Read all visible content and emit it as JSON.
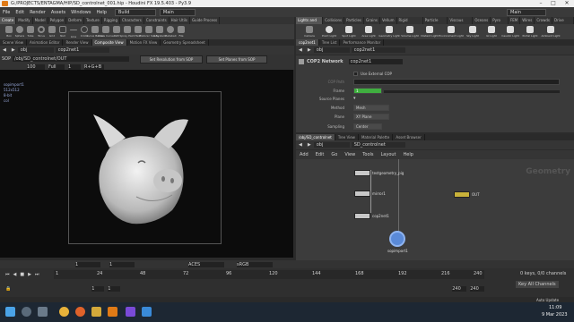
{
  "window": {
    "title": "G:/PROJECTS/ENTAGMA/HIP/SD_controlnet_001.hip - Houdini FX 19.5.403 - Py3.9"
  },
  "menu": {
    "items": [
      "File",
      "Edit",
      "Render",
      "Assets",
      "Windows",
      "Help"
    ],
    "desktop": "Build",
    "workspace": "Main"
  },
  "shelf_left": {
    "tabs": [
      "Create",
      "Modify",
      "Model",
      "Polygon",
      "Deform",
      "Texture",
      "Rigging",
      "Characters",
      "Constraints",
      "Hair Utils",
      "Guide Process"
    ],
    "tools": [
      "Box",
      "Sphere",
      "Tube",
      "Torus",
      "Grid",
      "Null",
      "Line",
      "Circle",
      "Curve Bezier",
      "Draw Curve",
      "Path",
      "Spray Paint",
      "Text",
      "Platonic Solids",
      "L-System",
      "Metaball",
      "File"
    ]
  },
  "shelf_right": {
    "tabs": [
      "Lights and ...",
      "Collisions",
      "Particles",
      "Grains",
      "Vellum",
      "Rigid Bodies",
      "Particle Fl...",
      "Viscous Fl...",
      "Oceans",
      "Pyro FX",
      "FEM",
      "Wires",
      "Crowds",
      "Drive Sim"
    ],
    "tools": [
      "Camera",
      "Point Light",
      "Spot Light",
      "Area Light",
      "Geometry Light",
      "Volume Light",
      "Distant Light",
      "Environment Light",
      "Sky Light",
      "GI Light",
      "Caustic Light",
      "Portal Light",
      "Ambient Light"
    ]
  },
  "left_panes": [
    "Scene View",
    "Animation Editor",
    "Render View",
    "Composite View",
    "Motion FX View",
    "Geometry Spreadsheet"
  ],
  "left_active_pane": "Composite View",
  "left_path": {
    "obj": "obj",
    "node": "cop2net1",
    "full_path": "/obj/SD_controlnet/OUT"
  },
  "left_toolbar": {
    "mode": "SOP",
    "buttons": [
      "Set Resolution from SOP",
      "Set Planes from SOP"
    ],
    "zoom": "100",
    "res": "Full",
    "frame": "1",
    "channel": "R+G+B"
  },
  "viewport": {
    "lines": [
      "sopimport1",
      "512x512",
      "8-bit",
      "col"
    ]
  },
  "right_panes": [
    "cop2net1",
    "Tree List",
    "Performance Monitor"
  ],
  "right_path": {
    "obj": "obj",
    "node": "cop2net1"
  },
  "node_header": {
    "type": "COP2 Network",
    "name": "cop2net1"
  },
  "params": {
    "use_external": "Use External COP",
    "cop_path_label": "COP Path",
    "frame_label": "Frame",
    "frame_value": "1",
    "source_planes_label": "Source Planes",
    "method_label": "Method",
    "method_value": "Mesh",
    "plane_label": "Plane",
    "plane_value": "XY Plane",
    "sampling_label": "Sampling",
    "sampling_value": "Center"
  },
  "network_tabs": [
    "/obj/SD_controlnet",
    "Tree View",
    "Material Palette",
    "Asset Browser"
  ],
  "network_path": {
    "obj": "obj",
    "node": "SD_controlnet"
  },
  "network_menu": [
    "Add",
    "Edit",
    "Go",
    "View",
    "Tools",
    "Layout",
    "Help"
  ],
  "network_watermark": "Geometry",
  "nodes": [
    {
      "label": "testgeometry_pig"
    },
    {
      "label": "mirror1"
    },
    {
      "label": "cop2net1"
    },
    {
      "label": "OUT"
    },
    {
      "label": "sopimport1"
    }
  ],
  "timeline": {
    "ticks": [
      "1",
      "24",
      "48",
      "72",
      "96",
      "120",
      "144",
      "168",
      "192",
      "216",
      "240"
    ],
    "start": "1",
    "end": "240",
    "current": "1",
    "fps_start": "1",
    "keys_label": "0 keys, 0/0 channels",
    "channels_label": "Key All Channels",
    "update_label": "Auto Update"
  },
  "viewport_opts": {
    "colorspace": "ACES",
    "display": "sRGB"
  },
  "clock": {
    "time": "11:09",
    "date": "9 Mar 2023"
  },
  "colors": {
    "accent": "#e07a16",
    "frame_green": "#3fae3f",
    "title_bg": "#f0f0f0",
    "taskbar": "#1d2733"
  }
}
